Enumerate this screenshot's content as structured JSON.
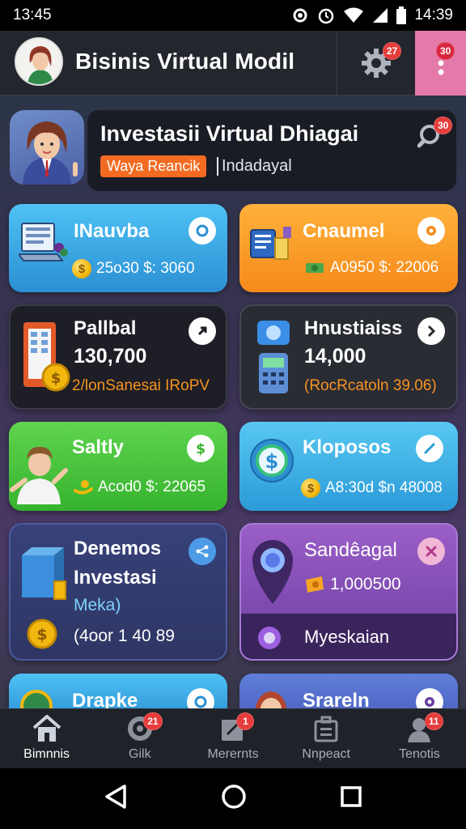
{
  "status_bar": {
    "time_left": "13:45",
    "time_right": "14:39"
  },
  "app_bar": {
    "title": "Bisinis Virtual Modil",
    "settings_badge": "27",
    "more_badge": "30"
  },
  "hero": {
    "title": "Investasii Virtual Dhiagai",
    "tag": "Waya Reancik",
    "subtitle": "Indadayal",
    "search_badge": "30"
  },
  "cards": [
    {
      "title": "INauvba",
      "stat": "25o30 $: 3060",
      "color": "#3aaee8"
    },
    {
      "title": "Cnaumel",
      "stat": "A0950 $: 22006",
      "color": "#f7931e"
    },
    {
      "title": "Pallbal",
      "value": "130,700",
      "stat": "2/lonSanesai IRoPV",
      "stat_color": "#f7931e"
    },
    {
      "title": "Hnustiaiss",
      "value": "14,000",
      "stat": "(RocRcatoln 39.06)",
      "stat_color": "#f7931e"
    },
    {
      "title": "Saltly",
      "stat": "Acod0 $: 22065",
      "color": "#44c53c"
    },
    {
      "title": "Kloposos",
      "stat": "A8:30d $n 48008",
      "color": "#2ea7df"
    },
    {
      "title": "Denemos",
      "title2": "Investasi",
      "subtitle": "Meka)",
      "stat": "(4oor 1 40 89"
    },
    {
      "title": "Sandêagal",
      "stat": "1,000500",
      "footer": "Myeskaian"
    },
    {
      "title": "Drapke"
    },
    {
      "title": "Srareln"
    }
  ],
  "bottom_nav": [
    {
      "label": "Bimnnis",
      "badge": ""
    },
    {
      "label": "Gilk",
      "badge": "21"
    },
    {
      "label": "Merernts",
      "badge": "1"
    },
    {
      "label": "Nnpeact",
      "badge": ""
    },
    {
      "label": "Tenotis",
      "badge": "11"
    }
  ]
}
